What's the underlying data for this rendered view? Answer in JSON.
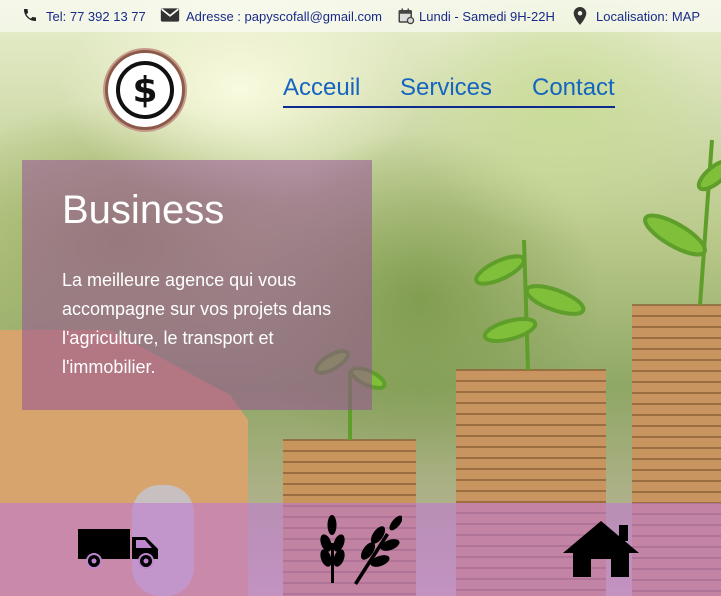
{
  "topbar": {
    "phone": "Tel: 77 392 13 77",
    "email": "Adresse : papyscofall@gmail.com",
    "hours": "Lundi - Samedi 9H-22H",
    "location": "Localisation: MAP",
    "icons": [
      "phone-icon",
      "envelope-icon",
      "calendar-icon",
      "map-pin-icon"
    ]
  },
  "logo": {
    "symbol": "$"
  },
  "nav": {
    "items": [
      {
        "label": "Acceuil"
      },
      {
        "label": "Services"
      },
      {
        "label": "Contact"
      }
    ]
  },
  "hero": {
    "title": "Business",
    "text": "La meilleure agence qui vous accompagne sur vos projets dans l'agriculture, le transport et l'immobilier."
  },
  "services": {
    "icons": [
      "truck-icon",
      "wheat-icon",
      "house-icon"
    ]
  },
  "colors": {
    "nav_link": "#1565c0",
    "nav_underline": "#0d2a8f",
    "topbar_text": "#1a2a8a",
    "hero_card": "#965096",
    "bottom_strip": "#be78d2"
  }
}
